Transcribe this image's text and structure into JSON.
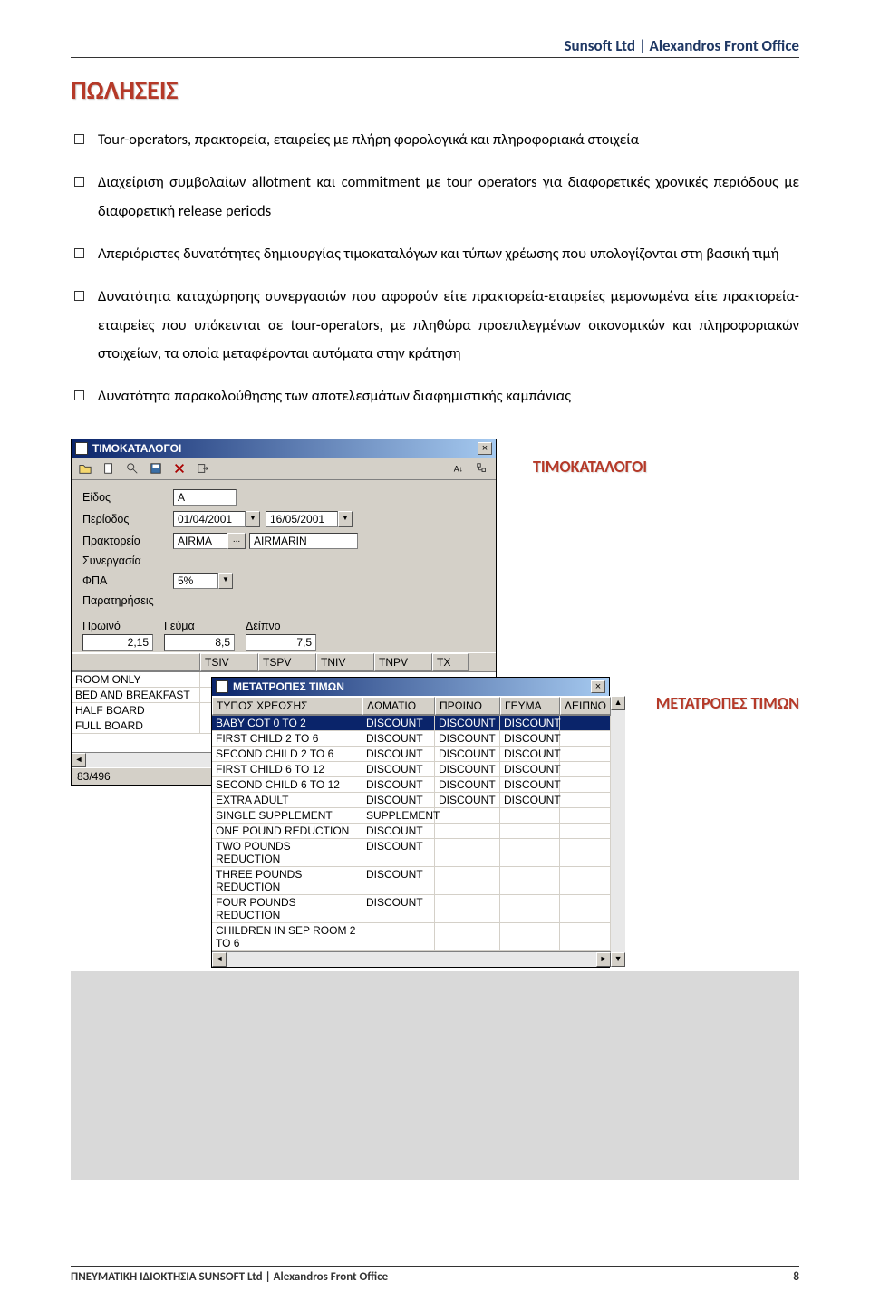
{
  "header": {
    "company": "Sunsoft Ltd",
    "product": "Alexandros Front Office",
    "sep": " | "
  },
  "section_title": "ΠΩΛΗΣΕΙΣ",
  "bullets": [
    "Tour-operators, πρακτορεία, εταιρείες με πλήρη φορολογικά και πληροφοριακά στοιχεία",
    "Διαχείριση συμβολαίων allotment και commitment με tour operators για διαφορετικές χρονικές περιόδους με διαφορετική release periods",
    "Απεριόριστες δυνατότητες δημιουργίας τιμοκαταλόγων και τύπων χρέωσης που υπολογίζονται στη βασική τιμή",
    "Δυνατότητα καταχώρησης συνεργασιών που αφορούν είτε πρακτορεία-εταιρείες μεμονωμένα είτε πρακτορεία-εταιρείες που υπόκεινται σε tour-operators, με πληθώρα προεπιλεγμένων οικονομικών και πληροφοριακών στοιχείων, τα οποία μεταφέρονται αυτόματα στην κράτηση",
    "Δυνατότητα παρακολούθησης των αποτελεσμάτων διαφημιστικής καμπάνιας"
  ],
  "panel1": {
    "heading": "ΤΙΜΟΚΑΤΑΛΟΓΟΙ",
    "title": "ΤΙΜΟΚΑΤΑΛΟΓΟΙ",
    "labels": {
      "eidos": "Είδος",
      "periodos": "Περίοδος",
      "praktoreio": "Πρακτορείο",
      "synergasia": "Συνεργασία",
      "fpa": "ΦΠΑ",
      "paratiriseis": "Παρατηρήσεις"
    },
    "values": {
      "eidos": "A",
      "date_from": "01/04/2001",
      "date_to": "16/05/2001",
      "agent_code": "AIRMA",
      "agent_name": "AIRMARIN",
      "synergasia": "",
      "fpa": "5%",
      "notes": ""
    },
    "meals": {
      "proino": "Πρωινό",
      "geuma": "Γεύμα",
      "deipno": "Δείπνο"
    },
    "meal_values": {
      "proino": "2,15",
      "geuma": "8,5",
      "deipno": "7,5"
    },
    "grid_cols": [
      "TSIV",
      "TSPV",
      "TNIV",
      "TNPV",
      "TX"
    ],
    "grid_rows": [
      "ROOM ONLY",
      "BED AND BREAKFAST",
      "HALF BOARD",
      "FULL BOARD"
    ],
    "status": "83/496"
  },
  "panel2": {
    "heading": "ΜΕΤΑΤΡΟΠΕΣ ΤΙΜΩΝ",
    "title": "ΜΕΤΑΤΡΟΠΕΣ ΤΙΜΩΝ",
    "cols": [
      "ΤΥΠΟΣ ΧΡΕΩΣΗΣ",
      "ΔΩΜΑΤΙΟ",
      "ΠΡΩΙΝΟ",
      "ΓΕΥΜΑ",
      "ΔΕΙΠΝΟ"
    ],
    "rows": [
      [
        "BABY COT 0 TO 2",
        "DISCOUNT",
        "DISCOUNT",
        "DISCOUNT",
        ""
      ],
      [
        "FIRST CHILD 2 TO 6",
        "DISCOUNT",
        "DISCOUNT",
        "DISCOUNT",
        ""
      ],
      [
        "SECOND CHILD 2 TO 6",
        "DISCOUNT",
        "DISCOUNT",
        "DISCOUNT",
        ""
      ],
      [
        "FIRST CHILD 6 TO 12",
        "DISCOUNT",
        "DISCOUNT",
        "DISCOUNT",
        ""
      ],
      [
        "SECOND CHILD 6 TO 12",
        "DISCOUNT",
        "DISCOUNT",
        "DISCOUNT",
        ""
      ],
      [
        "EXTRA ADULT",
        "DISCOUNT",
        "DISCOUNT",
        "DISCOUNT",
        ""
      ],
      [
        "SINGLE SUPPLEMENT",
        "SUPPLEMENT",
        "",
        "",
        ""
      ],
      [
        "ONE POUND REDUCTION",
        "DISCOUNT",
        "",
        "",
        ""
      ],
      [
        "TWO POUNDS REDUCTION",
        "DISCOUNT",
        "",
        "",
        ""
      ],
      [
        "THREE POUNDS REDUCTION",
        "DISCOUNT",
        "",
        "",
        ""
      ],
      [
        "FOUR POUNDS REDUCTION",
        "DISCOUNT",
        "",
        "",
        ""
      ],
      [
        "CHILDREN IN SEP ROOM 2 TO 6",
        "",
        "",
        "",
        ""
      ]
    ],
    "selected_row": 0
  },
  "footer": {
    "left": "ΠΝΕΥΜΑΤΙΚΗ ΙΔΙΟΚΤΗΣΙΑ  SUNSOFT Ltd  |  Alexandros Front Office",
    "page": "8"
  }
}
